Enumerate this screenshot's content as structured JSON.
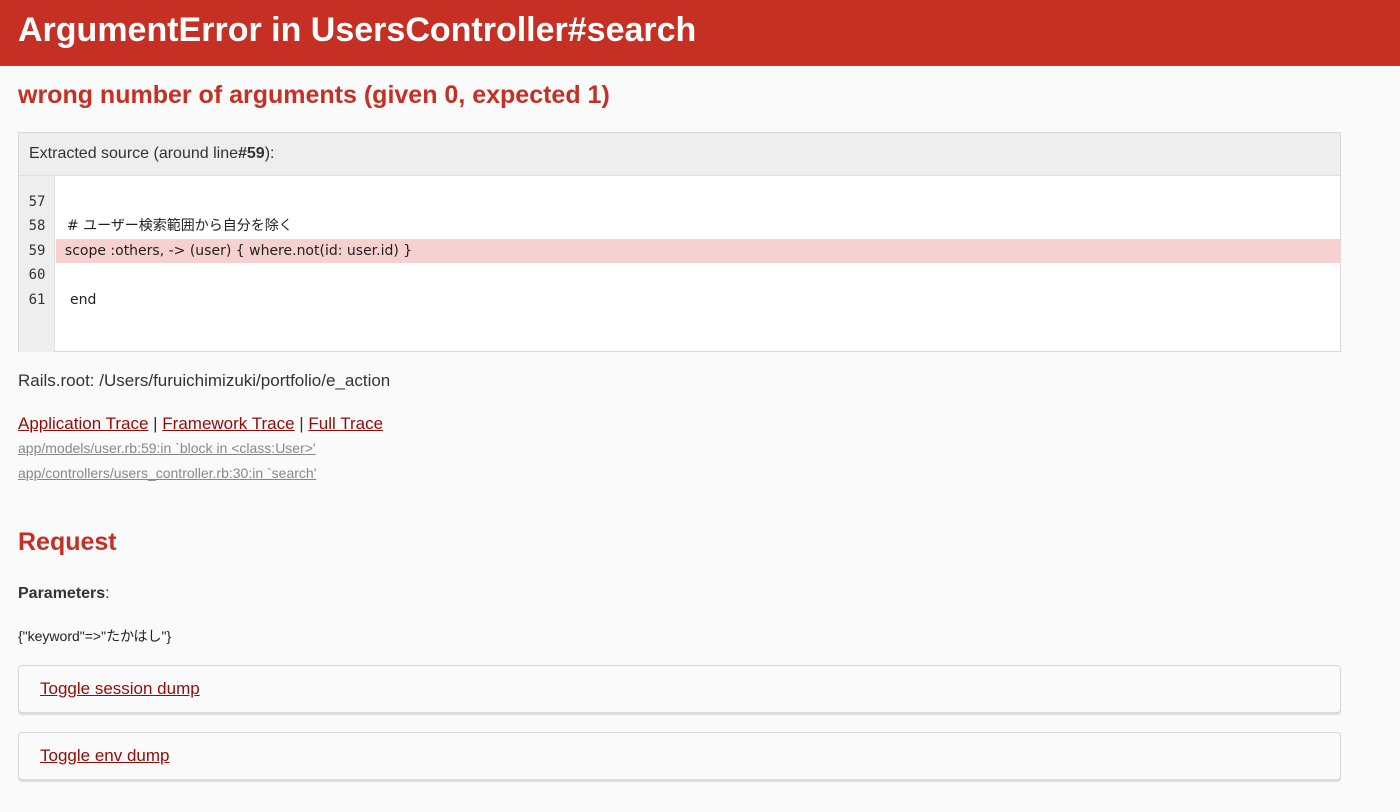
{
  "header": {
    "title": "ArgumentError in UsersController#search"
  },
  "error": {
    "message": "wrong number of arguments (given 0, expected 1)"
  },
  "source": {
    "heading_prefix": "Extracted source (around line ",
    "heading_line": "#59",
    "heading_suffix": "):",
    "lines": [
      {
        "num": "57",
        "code": ""
      },
      {
        "num": "58",
        "code": "  # ユーザー検索範囲から自分を除く"
      },
      {
        "num": "59",
        "code": "  scope :others, -> (user) { where.not(id: user.id) }"
      },
      {
        "num": "60",
        "code": ""
      },
      {
        "num": "61",
        "code": "end"
      }
    ]
  },
  "rails_root": "Rails.root: /Users/furuichimizuki/portfolio/e_action",
  "trace": {
    "application_label": "Application Trace",
    "separator": " | ",
    "framework_label": "Framework Trace",
    "full_label": "Full Trace",
    "items": [
      "app/models/user.rb:59:in `block in <class:User>'",
      "app/controllers/users_controller.rb:30:in `search'"
    ]
  },
  "request": {
    "heading": "Request",
    "parameters_label": "Parameters",
    "parameters_colon": ":",
    "parameters_value": "{\"keyword\"=>\"たかはし\"}"
  },
  "toggles": {
    "session": "Toggle session dump",
    "env": "Toggle env dump"
  },
  "colors": {
    "header_bg": "#c52f24",
    "link": "#980905",
    "highlight": "#f7d0d0"
  }
}
